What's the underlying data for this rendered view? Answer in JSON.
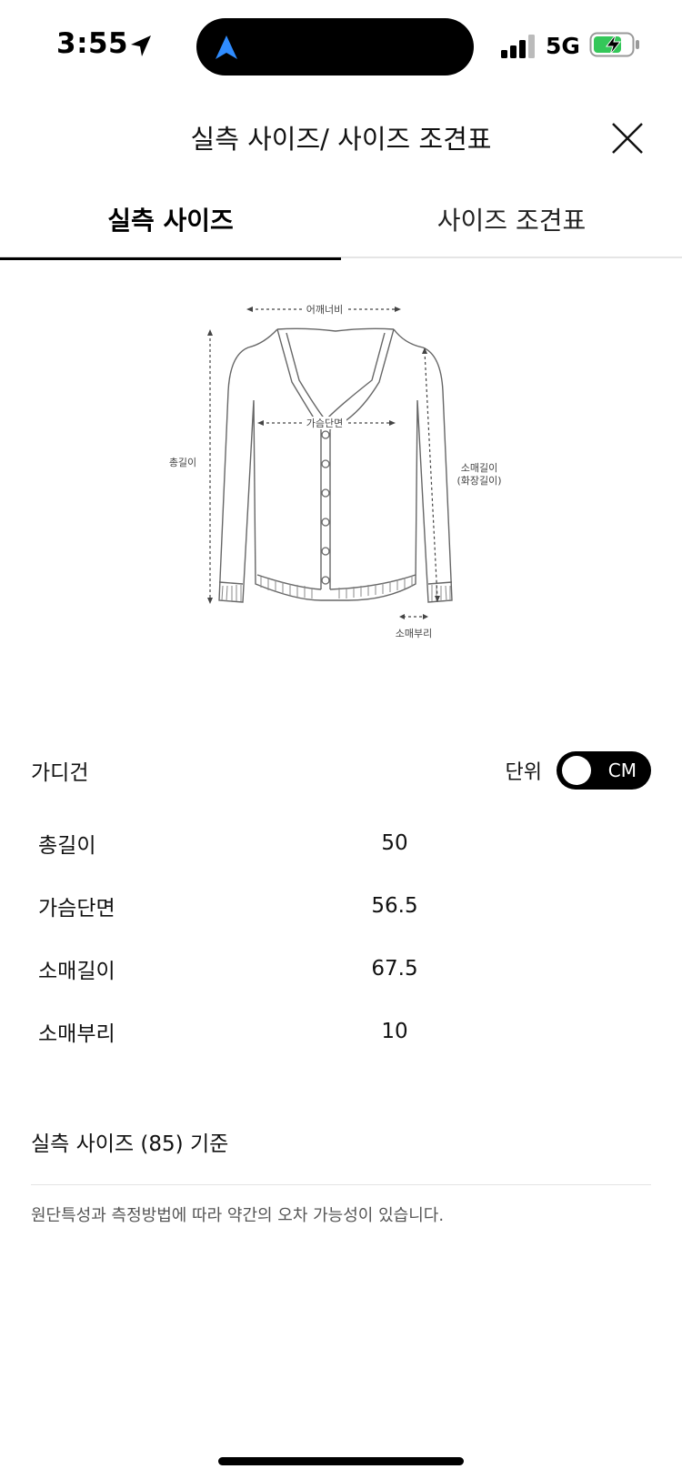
{
  "status": {
    "time": "3:55",
    "network": "5G"
  },
  "header": {
    "title": "실측 사이즈/ 사이즈 조견표"
  },
  "tabs": [
    {
      "label": "실측 사이즈",
      "active": true
    },
    {
      "label": "사이즈 조견표",
      "active": false
    }
  ],
  "diagram": {
    "shoulder": "어깨너비",
    "chest": "가슴단면",
    "total_length": "총길이",
    "sleeve_length": "소매길이",
    "sleeve_length_alt": "(화장길이)",
    "cuff": "소매부리"
  },
  "product": {
    "name": "가디건",
    "unit_label": "단위",
    "unit_value": "CM"
  },
  "sizes": [
    {
      "label": "총길이",
      "value": "50"
    },
    {
      "label": "가슴단면",
      "value": "56.5"
    },
    {
      "label": "소매길이",
      "value": "67.5"
    },
    {
      "label": "소매부리",
      "value": "10"
    }
  ],
  "basis": "실측 사이즈 (85) 기준",
  "note": "원단특성과 측정방법에 따라 약간의 오차 가능성이 있습니다.",
  "colors": {
    "accent": "#000000",
    "battery_green": "#34c759",
    "nav_blue": "#2f8cff"
  }
}
